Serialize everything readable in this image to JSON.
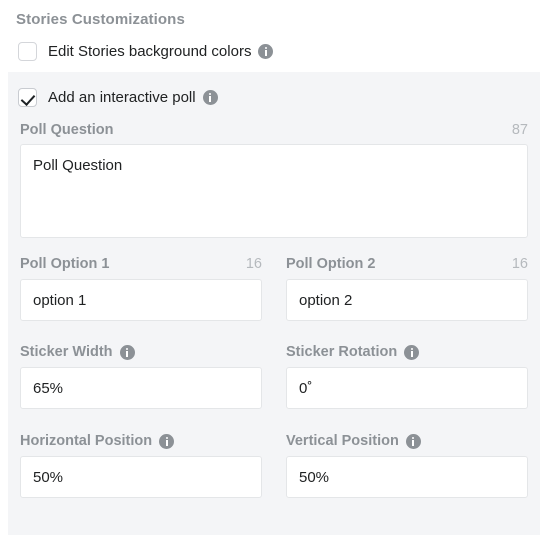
{
  "section": {
    "title": "Stories Customizations"
  },
  "options": [
    {
      "id": "edit-stories-background-colors",
      "label": "Edit Stories background colors",
      "checked": false,
      "has_info_icon": true,
      "info_icon": "info-icon"
    },
    {
      "id": "add-an-interactive-poll",
      "label": "Add an interactive poll",
      "checked": true,
      "has_info_icon": true,
      "info_icon": "info-icon"
    }
  ],
  "poll": {
    "question": {
      "label": "Poll Question",
      "counter": "87",
      "value": "Poll Question",
      "placeholder": ""
    },
    "option1": {
      "label": "Poll Option 1",
      "counter": "16",
      "value": "option 1",
      "placeholder": ""
    },
    "option2": {
      "label": "Poll Option 2",
      "counter": "16",
      "value": "option 2",
      "placeholder": ""
    },
    "sticker_width": {
      "label": "Sticker Width",
      "info_icon": "info-icon",
      "value": "65%",
      "placeholder": ""
    },
    "sticker_rotation": {
      "label": "Sticker Rotation",
      "info_icon": "info-icon",
      "value": "0˚",
      "placeholder": ""
    },
    "horizontal_position": {
      "label": "Horizontal Position",
      "info_icon": "info-icon",
      "value": "50%",
      "placeholder": ""
    },
    "vertical_position": {
      "label": "Vertical Position",
      "info_icon": "info-icon",
      "value": "50%",
      "placeholder": ""
    }
  },
  "colors": {
    "page_background": "#ffffff",
    "panel_background": "#f4f5f7",
    "label_text": "#8c9196",
    "value_text": "#202223",
    "counter_text": "#b5b9bd",
    "input_border": "#e4e6e8",
    "checkbox_border": "#d4d6da",
    "icon_fill": "#8c9196"
  }
}
